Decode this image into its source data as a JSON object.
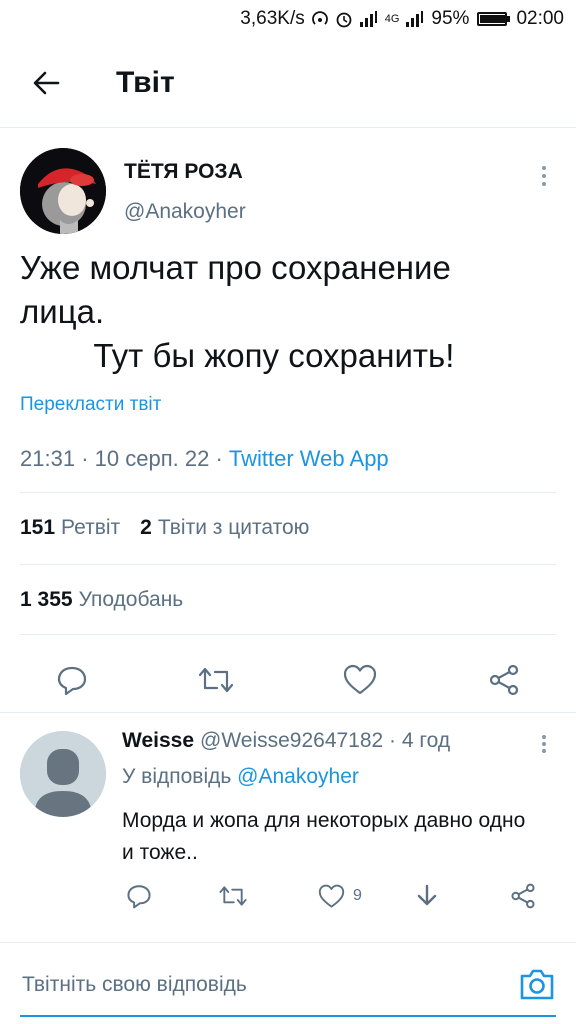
{
  "status_bar": {
    "speed": "3,63K/s",
    "network": "4G",
    "battery": "95%",
    "time": "02:00",
    "battery_level": 0.95
  },
  "header": {
    "title": "Твіт",
    "back_icon": "arrow-left-icon"
  },
  "tweet": {
    "author_name": "ТЁТЯ РОЗА",
    "author_handle": "@Anakoyher",
    "text": "Уже молчат про сохранение\nлица.\n        Тут бы жопу сохранить!",
    "translate_label": "Перекласти твіт",
    "time": "21:31",
    "date": "10 серп. 22",
    "source": "Twitter Web App",
    "retweets_count": "151",
    "retweets_label": "Ретвіт",
    "quotes_count": "2",
    "quotes_label": "Твіти з цитатою",
    "likes_count": "1 355",
    "likes_label": "Уподобань",
    "actions": [
      "reply-icon",
      "retweet-icon",
      "like-icon",
      "share-icon"
    ]
  },
  "reply": {
    "name": "Weisse",
    "handle": "@Weisse92647182",
    "time_ago": "4 год",
    "reply_to_prefix": "У відповідь",
    "reply_to_handle": "@Anakoyher",
    "text": "Морда и жопа для некоторых давно одно и тоже..",
    "likes_count": "9",
    "actions": [
      "reply-icon",
      "retweet-icon",
      "like-icon",
      "download-icon",
      "share-icon"
    ]
  },
  "compose": {
    "placeholder": "Твітніть свою відповідь",
    "camera_icon": "camera-icon"
  },
  "colors": {
    "accent": "#1b95e0",
    "secondary_text": "#5b7083",
    "primary_text": "#0f1419",
    "divider": "#e6ecf0"
  }
}
